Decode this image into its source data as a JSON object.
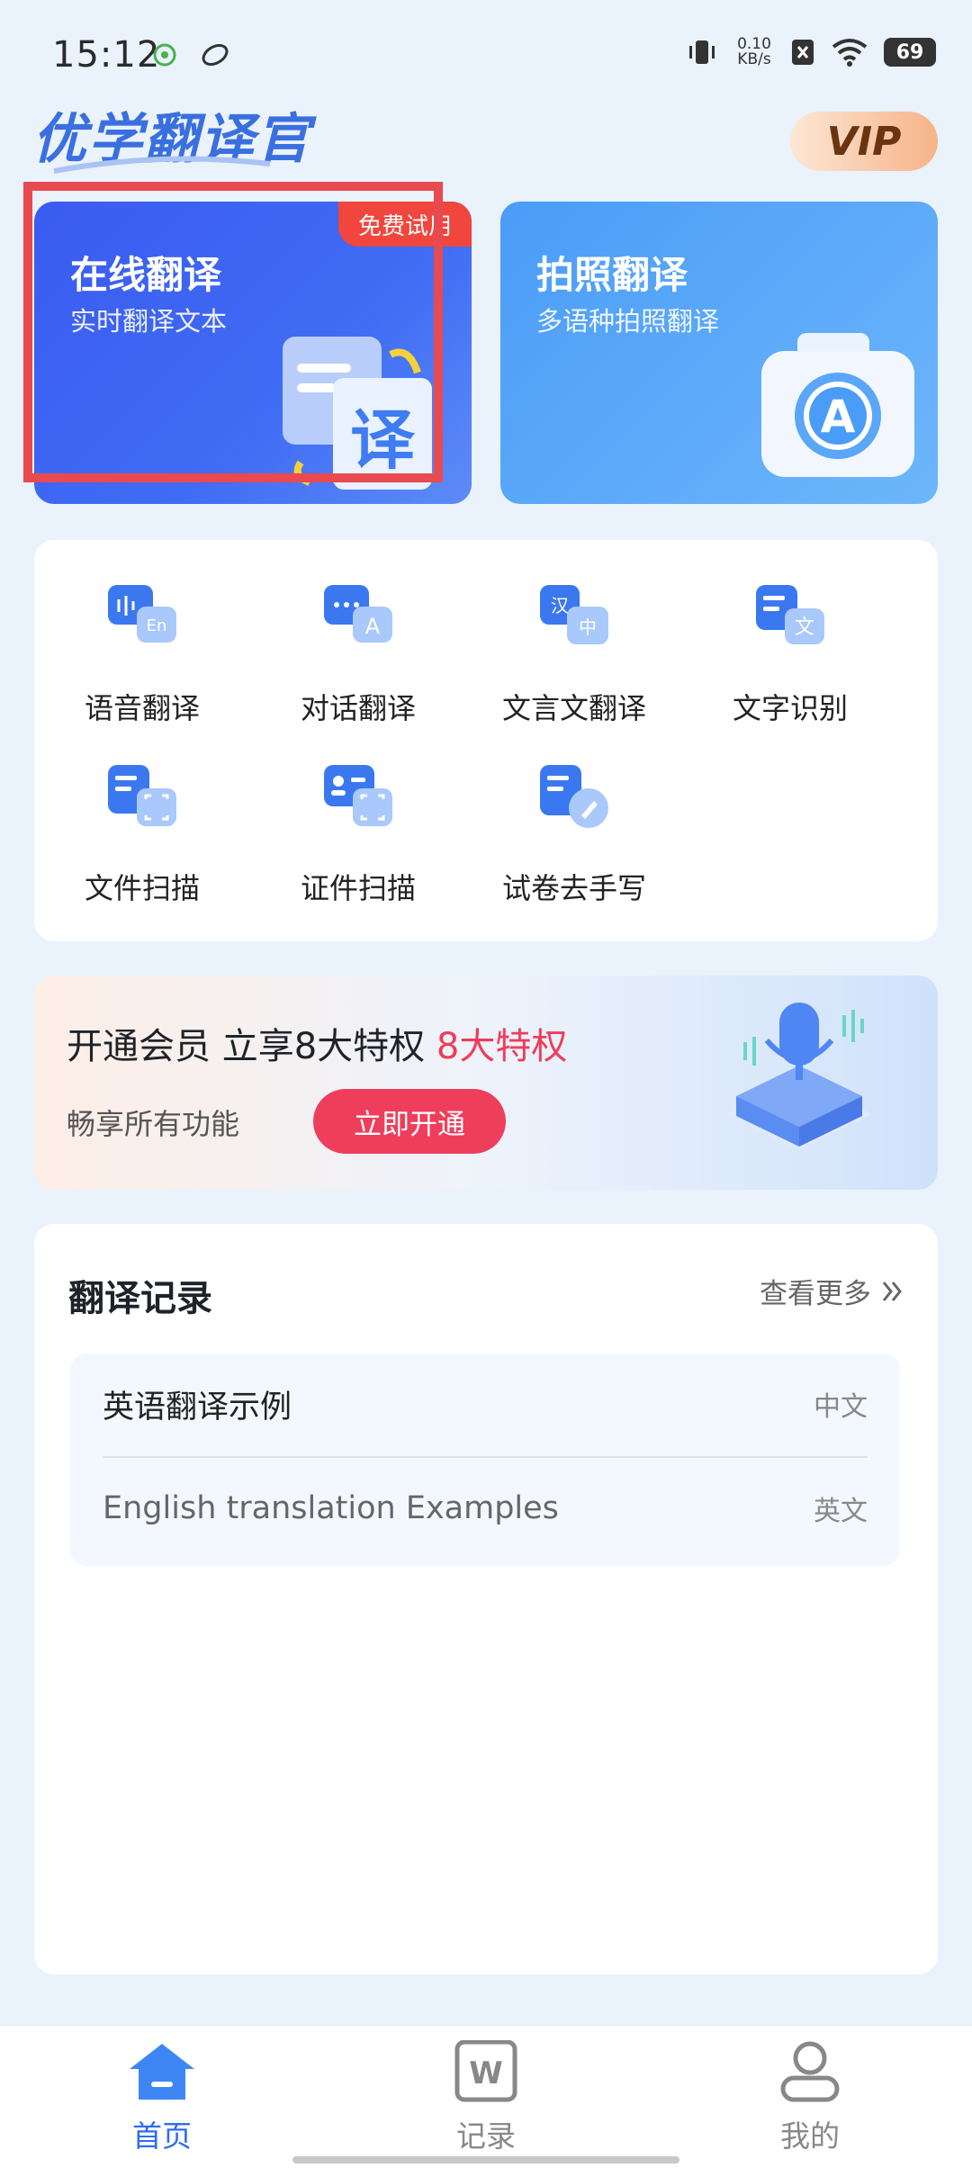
{
  "status_bar": {
    "time": "15:12",
    "net_speed_value": "0.10",
    "net_speed_unit": "KB/s",
    "battery": "69"
  },
  "header": {
    "app_title": "优学翻译官",
    "vip_label": "VIP"
  },
  "cards": {
    "online": {
      "title": "在线翻译",
      "subtitle": "实时翻译文本",
      "badge": "免费试用",
      "icon_glyph": "译"
    },
    "photo": {
      "title": "拍照翻译",
      "subtitle": "多语种拍照翻译",
      "icon_glyph": "A"
    }
  },
  "features": [
    {
      "label": "语音翻译",
      "icon": "voice-translate-icon",
      "glyph": "En"
    },
    {
      "label": "对话翻译",
      "icon": "dialog-translate-icon",
      "glyph": "A"
    },
    {
      "label": "文言文翻译",
      "icon": "classical-translate-icon",
      "glyph": "中",
      "glyph2": "汉"
    },
    {
      "label": "文字识别",
      "icon": "text-recognition-icon",
      "glyph": "文"
    },
    {
      "label": "文件扫描",
      "icon": "file-scan-icon"
    },
    {
      "label": "证件扫描",
      "icon": "id-scan-icon"
    },
    {
      "label": "试卷去手写",
      "icon": "remove-handwriting-icon"
    }
  ],
  "banner": {
    "title_main": "开通会员 立享8大特权",
    "title_highlight": "8大特权",
    "subtitle": "畅享所有功能",
    "button": "立即开通"
  },
  "history": {
    "title": "翻译记录",
    "more": "查看更多",
    "items": [
      {
        "text": "英语翻译示例",
        "lang": "中文"
      },
      {
        "text": "English translation Examples",
        "lang": "英文"
      }
    ]
  },
  "nav": {
    "items": [
      {
        "label": "首页",
        "icon": "home-icon"
      },
      {
        "label": "记录",
        "icon": "records-icon",
        "glyph": "W"
      },
      {
        "label": "我的",
        "icon": "profile-icon"
      }
    ]
  },
  "colors": {
    "primary": "#2e6df0",
    "accent_red": "#ee3e5c",
    "highlight_box": "#e84a4f"
  }
}
